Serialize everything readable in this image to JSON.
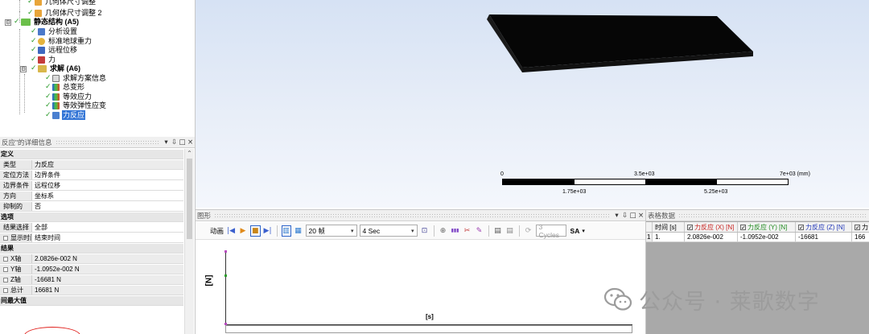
{
  "tree": {
    "items": [
      {
        "label": "几何体尺寸调整"
      },
      {
        "label": "几何体尺寸调整 2"
      },
      {
        "label": "静态结构 (A5)"
      },
      {
        "label": "分析设置"
      },
      {
        "label": "标准地球重力"
      },
      {
        "label": "远程位移"
      },
      {
        "label": "力"
      },
      {
        "label": "求解 (A6)"
      },
      {
        "label": "求解方案信息"
      },
      {
        "label": "总变形"
      },
      {
        "label": "等效应力"
      },
      {
        "label": "等效弹性应变"
      },
      {
        "label": "力反应"
      }
    ],
    "expand_symbol": "⊟"
  },
  "details": {
    "title": "反应\"的详细信息",
    "controls": [
      "▾",
      "⇩",
      "□",
      "×"
    ],
    "rows": [
      {
        "k": "定义",
        "v": ""
      },
      {
        "k": "类型",
        "v": "力反应"
      },
      {
        "k": "定位方法",
        "v": "边界条件"
      },
      {
        "k": "边界条件",
        "v": "远程位移"
      },
      {
        "k": "方向",
        "v": "坐标系"
      },
      {
        "k": "抑制的",
        "v": "否"
      },
      {
        "k": "选项",
        "v": ""
      },
      {
        "k": "结果选择",
        "v": "全部"
      },
      {
        "k": "显示时间",
        "v": "结束时间"
      },
      {
        "k": "结果",
        "v": ""
      },
      {
        "k": "X轴",
        "v": "2.0826e-002 N"
      },
      {
        "k": "Y轴",
        "v": "-1.0952e-002 N"
      },
      {
        "k": "Z轴",
        "v": "-16681 N"
      },
      {
        "k": "总计",
        "v": "16681 N"
      },
      {
        "k": "间最大值",
        "v": ""
      }
    ]
  },
  "scale": {
    "labels_top": [
      "0",
      "3.5e+03",
      "7e+03 (mm)"
    ],
    "labels_bottom": [
      "1.75e+03",
      "5.25e+03"
    ]
  },
  "graph": {
    "title": "图形",
    "controls": [
      "▾",
      "⇩",
      "□",
      "×"
    ],
    "animation_label": "动画",
    "frames": "20 帧",
    "duration": "4 Sec",
    "cycles": "3 Cycles",
    "sa_label": "SA",
    "y_axis_label": "[N]",
    "x_axis_label": "[s]",
    "icons": {
      "first": "|◀",
      "play": "▶",
      "stop": "■",
      "last": "▶|",
      "bars1": "▥",
      "bars2": "▦",
      "export": "⊡",
      "zoom": "⊕",
      "chart": "▮▮▮",
      "scissors": "✂",
      "brush": "✎",
      "grid1": "▤",
      "grid2": "▤",
      "cycle": "⟳"
    }
  },
  "table": {
    "title": "表格数据",
    "controls": [
      "▾",
      "⇩",
      "□",
      "×"
    ],
    "headers": [
      "",
      "时间 [s]",
      "力反应 (X) [N]",
      "力反应 (Y) [N]",
      "力反应 (Z) [N]",
      "力"
    ],
    "rows": [
      [
        "1",
        "1.",
        "2.0826e-002",
        "-1.0952e-002",
        "-16681",
        "166"
      ]
    ]
  },
  "watermark": "公众号 · 莱歌数字"
}
